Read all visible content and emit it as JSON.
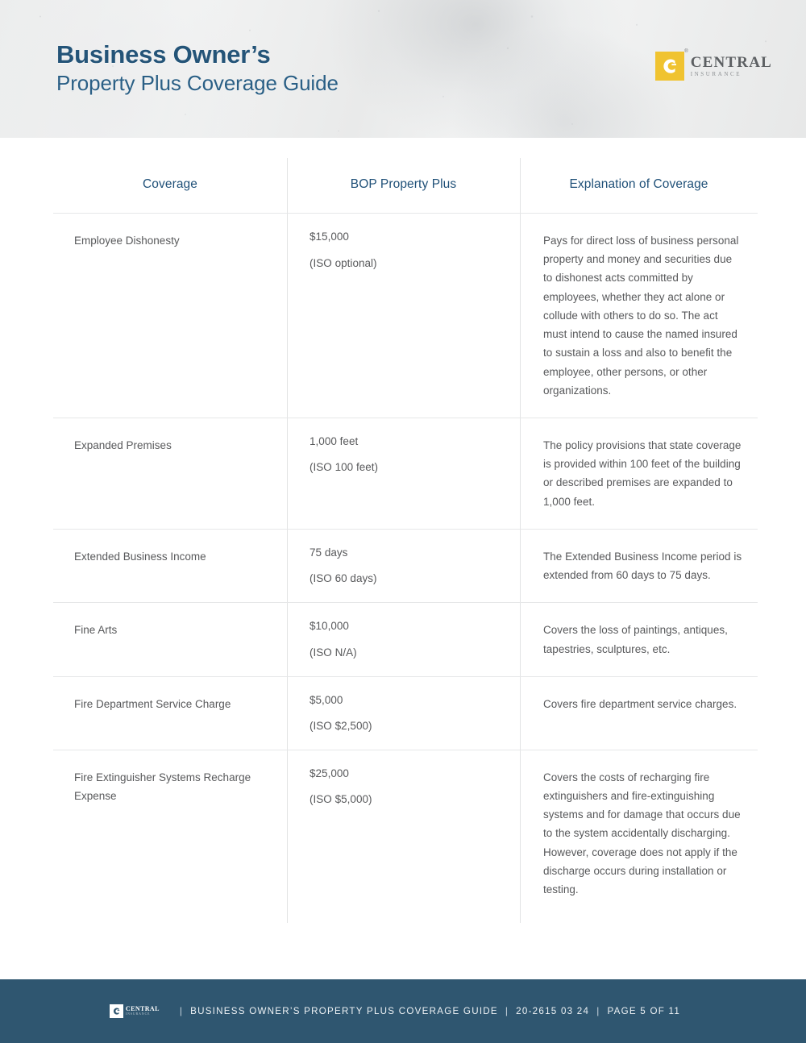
{
  "header": {
    "title_main": "Business Owner’s",
    "title_sub": "Property Plus Coverage Guide",
    "logo": {
      "name": "CENTRAL",
      "tagline": "INSURANCE",
      "registered_mark": "®",
      "mark_color": "#f0c330"
    },
    "accent_color": "#245478"
  },
  "table": {
    "columns": [
      {
        "label": "Coverage"
      },
      {
        "label": "BOP Property Plus"
      },
      {
        "label": "Explanation of Coverage"
      }
    ],
    "rows": [
      {
        "coverage": "Employee Dishonesty",
        "amount": "$15,000",
        "iso": "(ISO optional)",
        "explanation": "Pays for direct loss of business personal property and money and securities due to dishonest acts committed by employees, whether they act alone or collude with others to do so. The act must intend to cause the named insured to sustain a loss and also to benefit the employee, other persons, or other organizations."
      },
      {
        "coverage": "Expanded Premises",
        "amount": "1,000 feet",
        "iso": "(ISO 100 feet)",
        "explanation": "The policy provisions that state coverage is provided within 100 feet of the building or described premises are expanded to 1,000 feet."
      },
      {
        "coverage": "Extended Business Income",
        "amount": "75 days",
        "iso": "(ISO 60 days)",
        "explanation": "The Extended Business Income period is extended from 60 days to 75 days."
      },
      {
        "coverage": "Fine Arts",
        "amount": "$10,000",
        "iso": "(ISO N/A)",
        "explanation": "Covers the loss of paintings, antiques, tapestries, sculptures, etc."
      },
      {
        "coverage": "Fire Department Service Charge",
        "amount": "$5,000",
        "iso": "(ISO $2,500)",
        "explanation": "Covers fire department service charges."
      },
      {
        "coverage": "Fire Extinguisher Systems Recharge Expense",
        "amount": "$25,000",
        "iso": "(ISO $5,000)",
        "explanation": "Covers the costs of recharging fire extinguishers and fire-extinguishing systems and for damage that occurs due to the system accidentally discharging. However, coverage does not apply if the discharge occurs during installation or testing."
      }
    ]
  },
  "footer": {
    "logo": {
      "name": "CENTRAL",
      "tagline": "INSURANCE"
    },
    "separator": "|",
    "document_title": "BUSINESS OWNER’S PROPERTY PLUS COVERAGE GUIDE",
    "document_number": "20-2615 03 24",
    "page_label": "PAGE 5 OF 11",
    "background_color": "#2f5670"
  }
}
